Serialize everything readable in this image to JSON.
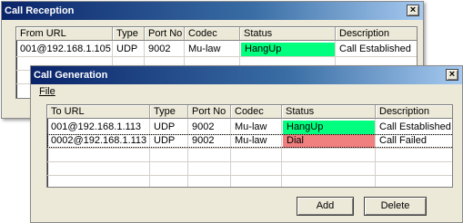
{
  "colors": {
    "hangup_green": "#00ff7f",
    "dial_red": "#f08080"
  },
  "reception": {
    "title": "Call Reception",
    "close_glyph": "×",
    "columns": [
      "From URL",
      "Type",
      "Port No",
      "Codec",
      "Status",
      "Description"
    ],
    "rows": [
      {
        "url": "001@192.168.1.105",
        "type": "UDP",
        "port": "9002",
        "codec": "Mu-law",
        "status": "HangUp",
        "description": "Call Established"
      }
    ]
  },
  "generation": {
    "title": "Call Generation",
    "close_glyph": "×",
    "menu_file": "File",
    "columns": [
      "To URL",
      "Type",
      "Port No",
      "Codec",
      "Status",
      "Description"
    ],
    "rows": [
      {
        "url": "001@192.168.1.113",
        "type": "UDP",
        "port": "9002",
        "codec": "Mu-law",
        "status": "HangUp",
        "description": "Call Established"
      },
      {
        "url": "0002@192.168.1.113",
        "type": "UDP",
        "port": "9002",
        "codec": "Mu-law",
        "status": "Dial",
        "description": "Call Failed"
      }
    ],
    "add_label": "Add",
    "delete_label": "Delete"
  }
}
